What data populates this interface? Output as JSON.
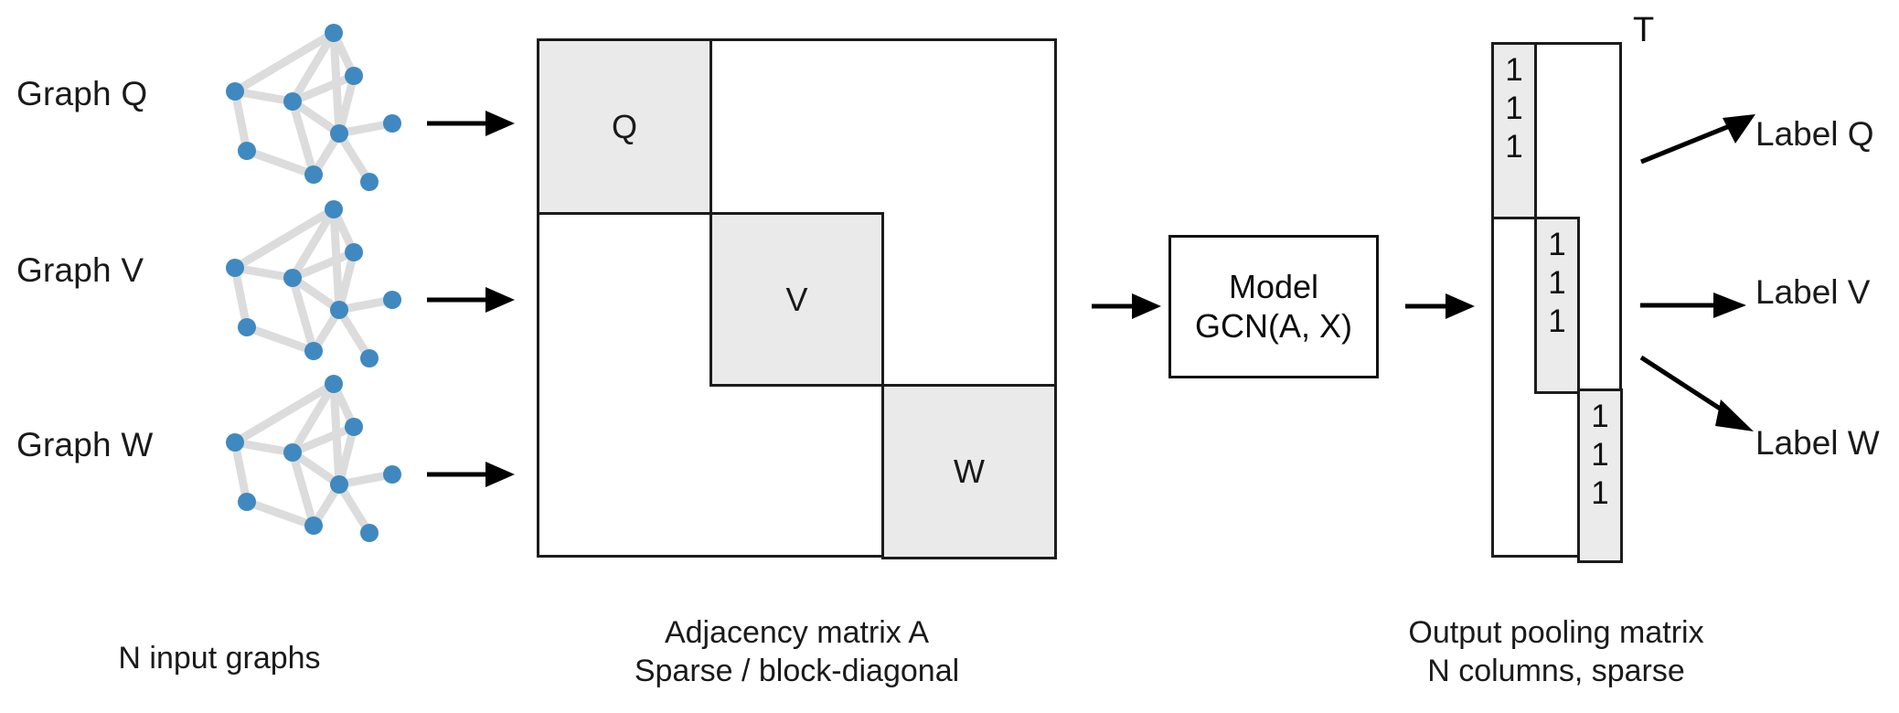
{
  "diagram": {
    "title_absent": true,
    "inputs": [
      {
        "label": "Graph Q",
        "arrow": "right-arrow-icon"
      },
      {
        "label": "Graph V",
        "arrow": "right-arrow-icon"
      },
      {
        "label": "Graph W",
        "arrow": "right-arrow-icon"
      }
    ],
    "adjacency": {
      "blocks": [
        {
          "letter": "Q"
        },
        {
          "letter": "V"
        },
        {
          "letter": "W"
        }
      ],
      "caption_line1": "Adjacency matrix A",
      "caption_line2": "Sparse / block-diagonal"
    },
    "model": {
      "line1": "Model",
      "line2": "GCN(A, X)"
    },
    "pooling": {
      "transpose_label": "T",
      "columns": [
        {
          "values": [
            "1",
            "1",
            "1"
          ]
        },
        {
          "values": [
            "1",
            "1",
            "1"
          ]
        },
        {
          "values": [
            "1",
            "1",
            "1"
          ]
        }
      ],
      "caption_line1": "Output pooling matrix",
      "caption_line2": "N columns, sparse"
    },
    "outputs": [
      {
        "label": "Label Q",
        "arrow": "arrow-up-right-icon"
      },
      {
        "label": "Label V",
        "arrow": "right-arrow-icon"
      },
      {
        "label": "Label W",
        "arrow": "arrow-down-right-icon"
      }
    ],
    "captions": {
      "inputs": "N input graphs"
    },
    "colors": {
      "node": "#3f89c0",
      "edge": "#dcdcdc",
      "block_fill": "#eaeaea",
      "stroke": "#1c1c1c",
      "text": "#111111",
      "background": "#ffffff"
    }
  }
}
